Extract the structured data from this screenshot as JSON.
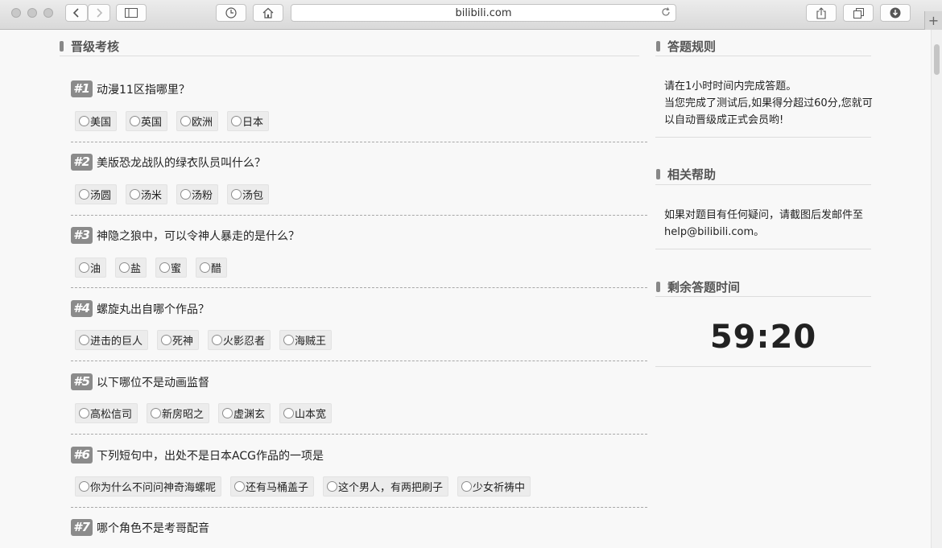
{
  "browser": {
    "url": "bilibili.com",
    "new_tab": "+"
  },
  "main": {
    "section_title": "晋级考核",
    "questions": [
      {
        "num": "#1",
        "text": "动漫11区指哪里？",
        "options": [
          "美国",
          "英国",
          "欧洲",
          "日本"
        ]
      },
      {
        "num": "#2",
        "text": "美版恐龙战队的绿衣队员叫什么？",
        "options": [
          "汤圆",
          "汤米",
          "汤粉",
          "汤包"
        ]
      },
      {
        "num": "#3",
        "text": "神隐之狼中，可以令神人暴走的是什么？",
        "options": [
          "油",
          "盐",
          "蜜",
          "醋"
        ]
      },
      {
        "num": "#4",
        "text": "螺旋丸出自哪个作品？",
        "options": [
          "进击的巨人",
          "死神",
          "火影忍者",
          "海贼王"
        ]
      },
      {
        "num": "#5",
        "text": "以下哪位不是动画监督",
        "options": [
          "高松信司",
          "新房昭之",
          "虚渊玄",
          "山本宽"
        ]
      },
      {
        "num": "#6",
        "text": "下列短句中，出处不是日本ACG作品的一项是",
        "options": [
          "你为什么不问问神奇海螺呢",
          "还有马桶盖子",
          "这个男人，有两把刷子",
          "少女祈祷中"
        ]
      },
      {
        "num": "#7",
        "text": "哪个角色不是考哥配音",
        "options": []
      }
    ]
  },
  "sidebar": {
    "rules": {
      "title": "答题规则",
      "lines": [
        "请在1小时时间内完成答题。",
        "当您完成了测试后,如果得分超过60分,您就可",
        "以自动晋级成正式会员哟!"
      ]
    },
    "help": {
      "title": "相关帮助",
      "lines": [
        "如果对题目有任何疑问，请截图后发邮件至",
        "help@bilibili.com。"
      ]
    },
    "timer": {
      "title": "剩余答题时间",
      "value": "59:20"
    }
  }
}
